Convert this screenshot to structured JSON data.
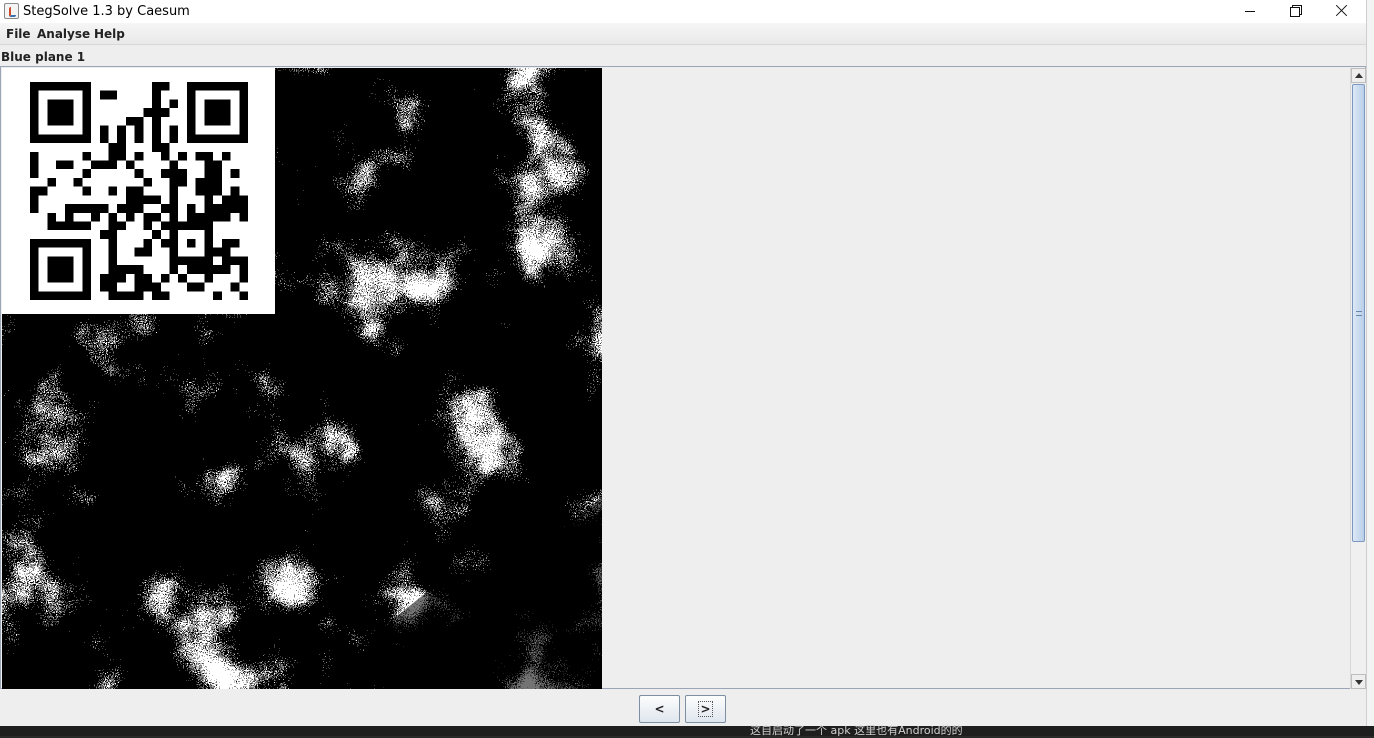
{
  "window": {
    "title": "StegSolve 1.3 by Caesum"
  },
  "menubar": {
    "items": [
      "File",
      "Analyse",
      "Help"
    ]
  },
  "viewer": {
    "plane_label": "Blue plane 1"
  },
  "navigation": {
    "prev_label": "<",
    "next_label": ">"
  },
  "background_taskbar": {
    "text": "这自启动了一个 apk 这里也有Android的的"
  }
}
